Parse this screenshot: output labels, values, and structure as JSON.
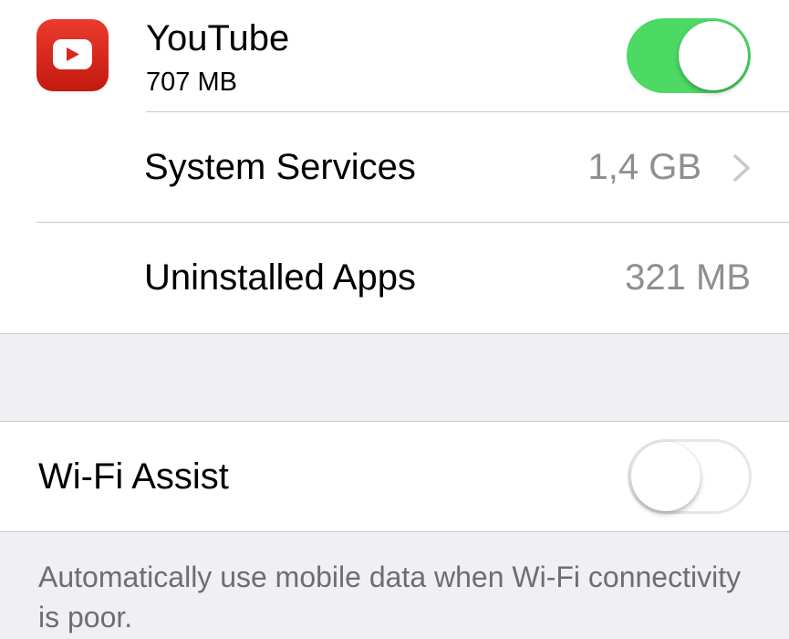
{
  "apps": [
    {
      "name": "YouTube",
      "size": "707 MB",
      "mobile_data_enabled": true,
      "icon": "youtube-icon",
      "icon_color": "#e62117"
    }
  ],
  "system_services": {
    "label": "System Services",
    "value": "1,4 GB"
  },
  "uninstalled_apps": {
    "label": "Uninstalled Apps",
    "value": "321 MB"
  },
  "wifi_assist": {
    "label": "Wi-Fi Assist",
    "enabled": false,
    "footer": "Automatically use mobile data when Wi-Fi connectivity is poor."
  },
  "colors": {
    "toggle_on": "#4cd964",
    "secondary_text": "#8e8e93",
    "footer_text": "#6d6d72",
    "group_background": "#efeff4"
  }
}
